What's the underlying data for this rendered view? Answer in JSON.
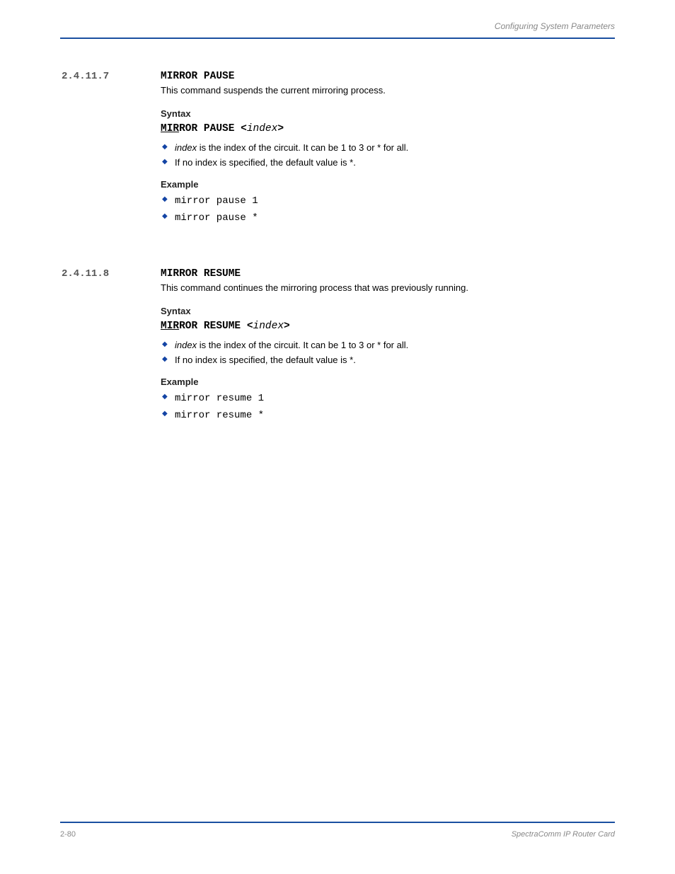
{
  "header": {
    "title": "Configuring System Parameters"
  },
  "sections": [
    {
      "num": "2.4.11.7",
      "cmd": "MIRROR PAUSE",
      "desc": "This command suspends the current mirroring process.",
      "syntaxLabel": "Syntax",
      "abbr": "MIR",
      "rest": "ROR PAUSE <",
      "param": "index",
      "close": ">",
      "bullets": [
        {
          "label": "index",
          "text": " is the index of the circuit. It can be 1 to 3 or * for all."
        },
        {
          "label": "",
          "text": "If no index is specified, the default value is *."
        }
      ],
      "exampleLabel": "Example",
      "examples": [
        "mirror pause 1",
        "mirror pause *"
      ]
    },
    {
      "num": "2.4.11.8",
      "cmd": "MIRROR RESUME",
      "desc": "This command continues the mirroring process that was previously running.",
      "syntaxLabel": "Syntax",
      "abbr": "MIR",
      "rest": "ROR RESUME <",
      "param": "index",
      "close": ">",
      "bullets": [
        {
          "label": "index",
          "text": " is the index of the circuit. It can be 1 to 3 or * for all."
        },
        {
          "label": "",
          "text": "If no index is specified, the default value is *."
        }
      ],
      "exampleLabel": "Example",
      "examples": [
        "mirror resume 1",
        "mirror resume *"
      ]
    }
  ],
  "footer": {
    "left": "2-80",
    "right": "SpectraComm IP Router Card"
  }
}
